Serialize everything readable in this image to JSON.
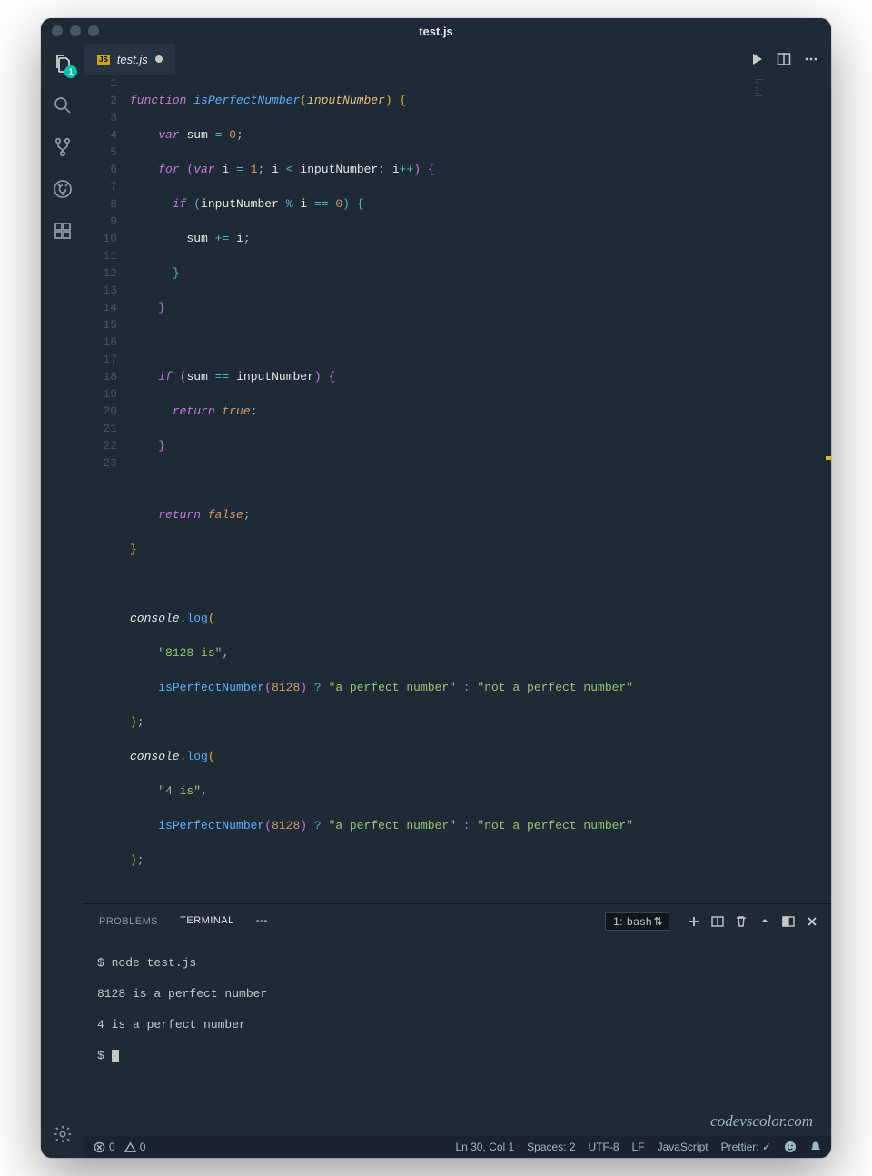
{
  "window": {
    "title": "test.js"
  },
  "activity_bar": {
    "explorer_badge": "1"
  },
  "tab": {
    "filename": "test.js",
    "lang_badge": "JS"
  },
  "code": {
    "lines": [
      1,
      2,
      3,
      4,
      5,
      6,
      7,
      8,
      9,
      10,
      11,
      12,
      13,
      14,
      15,
      16,
      17,
      18,
      19,
      20,
      21,
      22,
      23
    ]
  },
  "panel": {
    "tabs": {
      "problems": "PROBLEMS",
      "terminal": "TERMINAL",
      "more": "•••"
    },
    "terminal_selector": "1: bash"
  },
  "terminal": {
    "line1": "$ node test.js",
    "line2": "8128 is a perfect number",
    "line3": "4 is a perfect number",
    "prompt": "$ "
  },
  "watermark": "codevscolor.com",
  "statusbar": {
    "errors": "0",
    "warnings": "0",
    "lncol": "Ln 30, Col 1",
    "spaces": "Spaces: 2",
    "encoding": "UTF-8",
    "eol": "LF",
    "language": "JavaScript",
    "prettier": "Prettier: ✓"
  },
  "tokens": {
    "function": "function",
    "isPerfectNumber": "isPerfectNumber",
    "inputNumber": "inputNumber",
    "var": "var",
    "sum": "sum",
    "for": "for",
    "i": "i",
    "if": "if",
    "return": "return",
    "true": "true",
    "false": "false",
    "console": "console",
    "log": "log",
    "str_8128_is": "\"8128 is\"",
    "str_4_is": "\"4 is\"",
    "str_perfect": "\"a perfect number\"",
    "str_not_perfect": "\"not a perfect number\"",
    "n0": "0",
    "n1": "1",
    "n8128": "8128",
    "eq": "=",
    "eqeq": "==",
    "plus_eq": "+=",
    "lt": "<",
    "pp": "++",
    "mod": "%",
    "qmark": "?",
    "colon": ":",
    "semi": ";",
    "comma": ",",
    "dot": ".",
    "lp_y": "(",
    "rp_y": ")",
    "lb_y": "{",
    "rb_y": "}",
    "lp_p": "(",
    "rp_p": ")",
    "lb_p": "{",
    "rb_p": "}",
    "lp_b": "(",
    "rp_b": ")",
    "lb_b": "{",
    "rb_b": "}"
  }
}
